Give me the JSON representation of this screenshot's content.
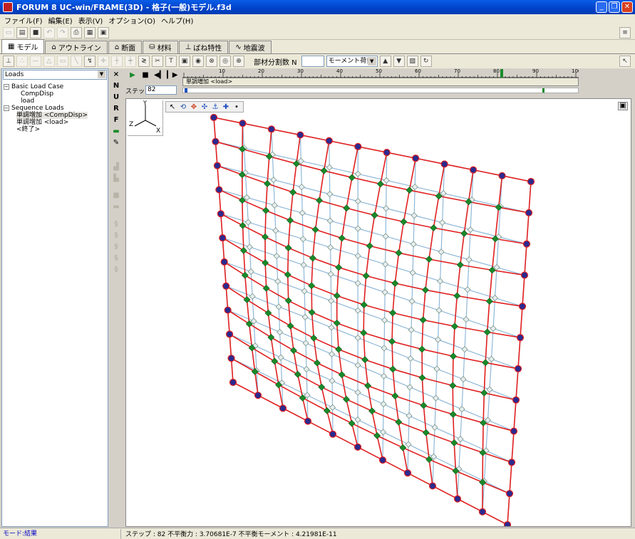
{
  "window": {
    "title": "FORUM 8 UC-win/FRAME(3D) - 格子(一般)モデル.f3d"
  },
  "menu": [
    "ファイル(F)",
    "編集(E)",
    "表示(V)",
    "オプション(O)",
    "ヘルプ(H)"
  ],
  "tabs": [
    {
      "label": "モデル",
      "active": true
    },
    {
      "label": "アウトライン"
    },
    {
      "label": "断面"
    },
    {
      "label": "材料"
    },
    {
      "label": "ばね特性"
    },
    {
      "label": "地震波"
    }
  ],
  "toolbar2": {
    "division_label": "部材分割数 N",
    "mode_select": "モーメント荷重"
  },
  "left_panel": {
    "combo_value": "Loads",
    "tree": [
      {
        "label": "Basic Load Case",
        "level": 1
      },
      {
        "label": "CompDisp",
        "level": 2
      },
      {
        "label": "load",
        "level": 2
      },
      {
        "label": "Sequence Loads",
        "level": 1
      },
      {
        "label": "単調増加 <CompDisp>",
        "level": 2,
        "selected": true
      },
      {
        "label": "単調増加 <load>",
        "level": 2
      },
      {
        "label": "<終了>",
        "level": 2
      }
    ]
  },
  "vtoolbar": [
    "×",
    "N",
    "U",
    "R",
    "F"
  ],
  "player": {
    "ruler_ticks": [
      "10",
      "20",
      "30",
      "40",
      "50",
      "60",
      "70",
      "80",
      "90",
      "100"
    ],
    "load_row": "単調増加 <load>",
    "step_label": "ステップ",
    "step_value": "82"
  },
  "axes": {
    "z": "Z",
    "x": "X",
    "y": "Y"
  },
  "status": {
    "mode": "モード:結果",
    "info": "ステップ : 82 不平衡力 : 3.70681E-7 不平衡モーメント : 4.21981E-11"
  },
  "colors": {
    "member_deformed": "#e02020",
    "member_undeformed": "#8fb8d8",
    "node_edge": "#2a2a90",
    "node_green": "#1a8a2a",
    "title_bar": "#0a5de8"
  }
}
